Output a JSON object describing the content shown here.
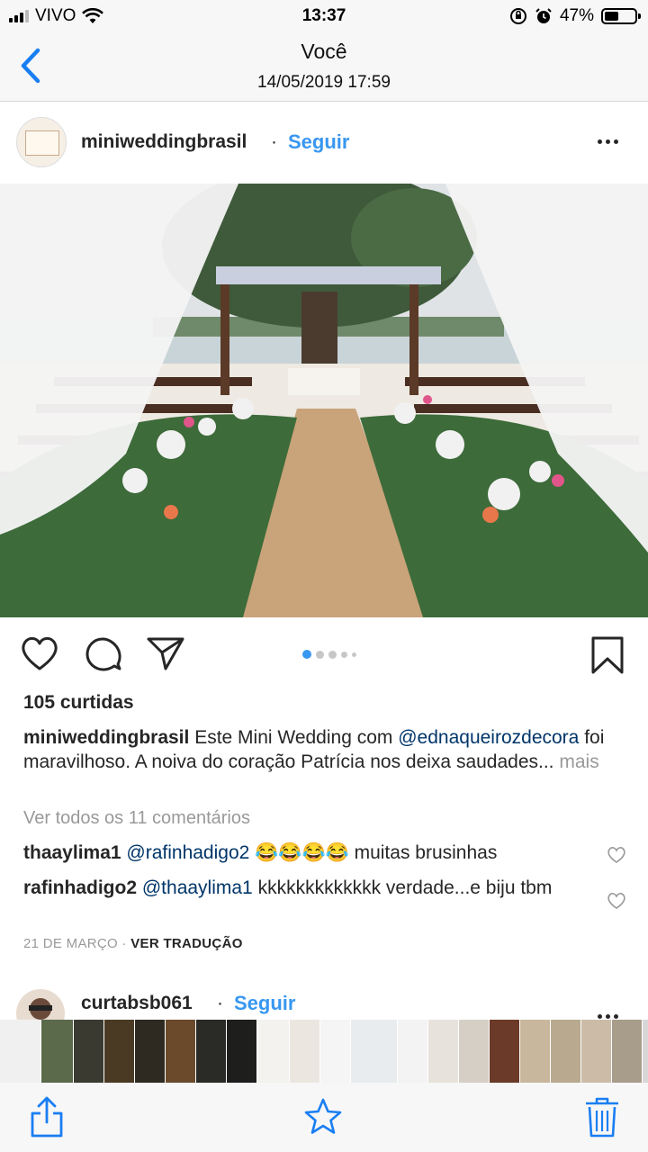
{
  "status": {
    "carrier": "VIVO",
    "time": "13:37",
    "battery": "47%",
    "battery_level": 0.47
  },
  "nav": {
    "title": "Você",
    "subtitle": "14/05/2019 17:59"
  },
  "post": {
    "username": "miniweddingbrasil",
    "separator": "·",
    "follow": "Seguir",
    "carousel": {
      "count": 5,
      "active": 0
    },
    "likes": "105 curtidas",
    "caption": {
      "user": "miniweddingbrasil",
      "text1": " Este Mini Wedding com ",
      "mention": "@ednaqueirozdecora",
      "text2": " foi maravilhoso. A noiva do coração Patrícia nos deixa saudades...",
      "more": " mais"
    },
    "view_all": "Ver todos os 11 comentários",
    "comments": [
      {
        "user": "thaaylima1",
        "mention": "@rafinhadigo2",
        "text": " 😂😂😂😂 muitas brusinhas"
      },
      {
        "user": "rafinhadigo2",
        "mention": "@thaaylima1",
        "text": " kkkkkkkkkkkkk verdade...e biju tbm"
      }
    ],
    "date": "21 DE MARÇO",
    "date_sep": " · ",
    "translate": "VER TRADUÇÃO"
  },
  "post2": {
    "username": "curtabsb061",
    "separator": "·",
    "follow": "Seguir"
  },
  "colors": {
    "accent": "#3897f0",
    "mention": "#003569",
    "muted": "#999999",
    "ios_blue": "#1a7ef2"
  },
  "icons": [
    "back-chevron-icon",
    "heart-icon",
    "comment-icon",
    "share-icon",
    "bookmark-icon",
    "more-icon",
    "upload-icon",
    "star-icon",
    "trash-icon"
  ]
}
